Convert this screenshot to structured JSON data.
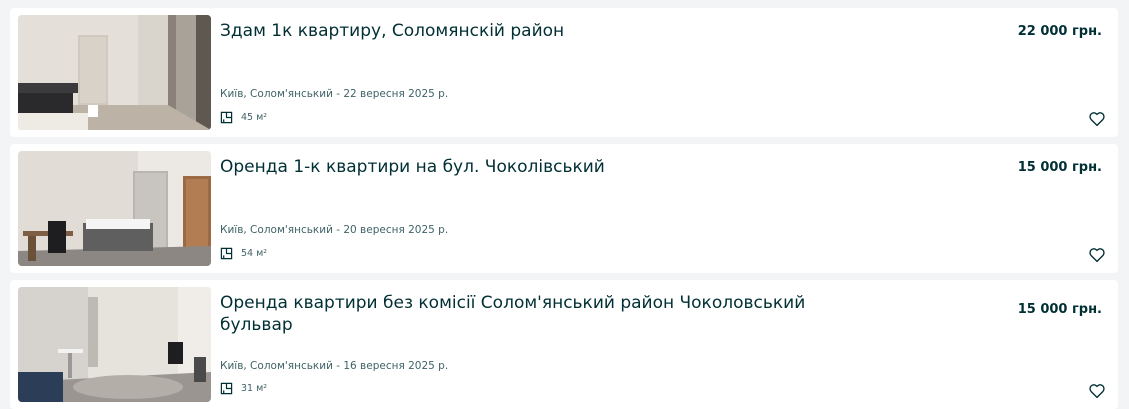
{
  "listings": [
    {
      "title": "Здам 1к квартиру, Соломянскій район",
      "price": "22 000 грн.",
      "location_date": "Київ, Солом'янський - 22 вересня 2025 р.",
      "area": "45 м²",
      "icons": {
        "area": "floor-plan-icon",
        "favorite": "heart-icon"
      }
    },
    {
      "title": "Оренда 1-к квартири на бул. Чоколівський",
      "price": "15 000 грн.",
      "location_date": "Київ, Солом'янський - 20 вересня 2025 р.",
      "area": "54 м²",
      "icons": {
        "area": "floor-plan-icon",
        "favorite": "heart-icon"
      }
    },
    {
      "title": "Оренда квартири без комісії Солом'янський район Чоколовський бульвар",
      "price": "15 000 грн.",
      "location_date": "Київ, Солом'янський - 16 вересня 2025 р.",
      "area": "31 м²",
      "icons": {
        "area": "floor-plan-icon",
        "favorite": "heart-icon"
      }
    }
  ],
  "colors": {
    "background": "#f2f4f5",
    "card": "#ffffff",
    "text_primary": "#002f34",
    "text_secondary": "#406367"
  }
}
